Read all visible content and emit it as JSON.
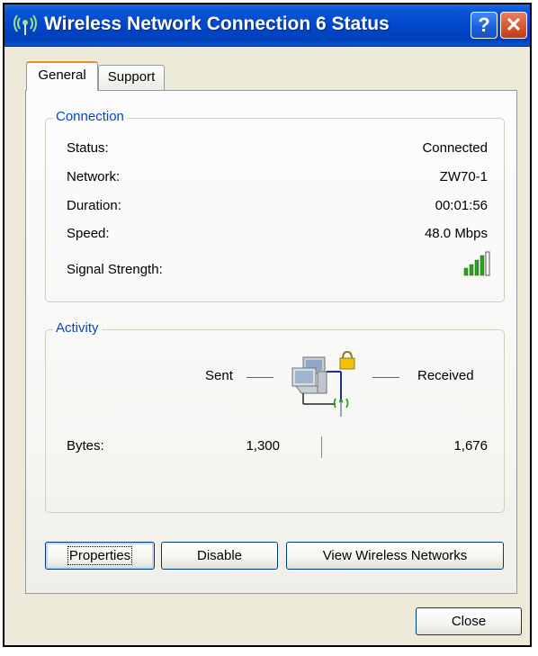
{
  "window": {
    "title": "Wireless Network Connection 6 Status",
    "help_button_label": "?",
    "close_button_label": "✕"
  },
  "tabs": [
    {
      "label": "General",
      "selected": true
    },
    {
      "label": "Support",
      "selected": false
    }
  ],
  "connection": {
    "legend": "Connection",
    "status_label": "Status:",
    "status_value": "Connected",
    "network_label": "Network:",
    "network_value": "ZW70-1",
    "duration_label": "Duration:",
    "duration_value": "00:01:56",
    "speed_label": "Speed:",
    "speed_value": "48.0 Mbps",
    "signal_label": "Signal Strength:",
    "signal_bars_lit": 4,
    "signal_bars_total": 5
  },
  "activity": {
    "legend": "Activity",
    "sent_label": "Sent",
    "received_label": "Received",
    "bytes_label": "Bytes:",
    "bytes_sent": "1,300",
    "bytes_received": "1,676"
  },
  "buttons": {
    "properties": "Properties",
    "disable": "Disable",
    "view_networks": "View Wireless Networks",
    "close": "Close"
  },
  "colors": {
    "title_bar": "#0047c7",
    "group_legend": "#0046d5",
    "signal_green": "#2e9e22",
    "tab_highlight": "#e68b2c"
  },
  "icons": {
    "title": "wireless-signal-icon",
    "activity": "network-computers-icon",
    "lock": "lock-icon",
    "signal": "signal-strength-icon"
  }
}
